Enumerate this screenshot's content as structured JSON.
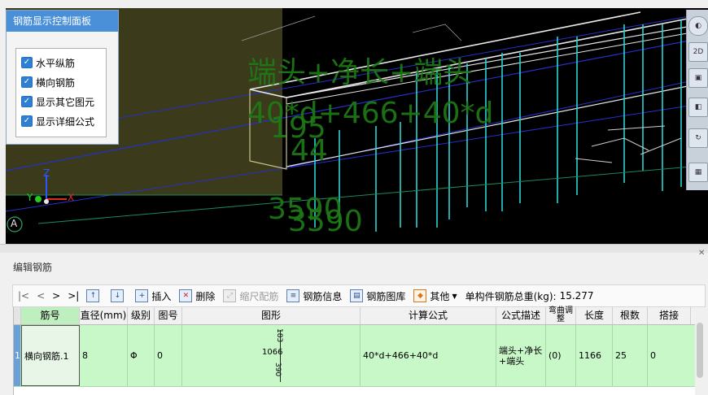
{
  "viewport": {
    "overlay_lines": [
      "端头+净长+端头",
      "40*d+466+40*d",
      "195",
      "44",
      "3590",
      "3590"
    ],
    "axis_labels": {
      "x": "X",
      "y": "Y",
      "z": "Z"
    },
    "corner_badge": "A"
  },
  "control_panel": {
    "title": "钢筋显示控制面板",
    "options": [
      {
        "label": "水平纵筋",
        "checked": true
      },
      {
        "label": "横向钢筋",
        "checked": true
      },
      {
        "label": "显示其它图元",
        "checked": true
      },
      {
        "label": "显示详细公式",
        "checked": true
      }
    ]
  },
  "right_toolbar": {
    "view_2d_label": "2D"
  },
  "edit_panel": {
    "title": "编辑钢筋",
    "toolbar": {
      "nav": [
        "|<",
        "<",
        ">",
        ">|"
      ],
      "insert": "插入",
      "delete": "删除",
      "scale_rebar": "缩尺配筋",
      "rebar_info": "钢筋信息",
      "rebar_library": "钢筋图库",
      "other": "其他",
      "total_weight_label": "单构件钢筋总重(kg):",
      "total_weight_value": "15.277"
    },
    "columns": [
      "筋号",
      "直径(mm)",
      "级别",
      "图号",
      "图形",
      "计算公式",
      "公式描述",
      "弯曲调整",
      "长度",
      "根数",
      "搭接"
    ],
    "rows": [
      {
        "index": "1",
        "bar_no": "横向钢筋.1",
        "diameter": "8",
        "grade": "Φ",
        "fig_no": "0",
        "shape_dims": {
          "left": "1066",
          "top": "183",
          "bottom": "390"
        },
        "formula": "40*d+466+40*d",
        "description": "端头+净长+端头",
        "bend_adjust": "(0)",
        "length": "1166",
        "count": "25",
        "lap": "0"
      }
    ]
  },
  "colors": {
    "viewport_bg": "#000000",
    "rebar_cyan": "#2ad4d4",
    "label_green": "#1e7a16",
    "row_green": "#c8f7c8",
    "panel_blue": "#4a90d9"
  }
}
